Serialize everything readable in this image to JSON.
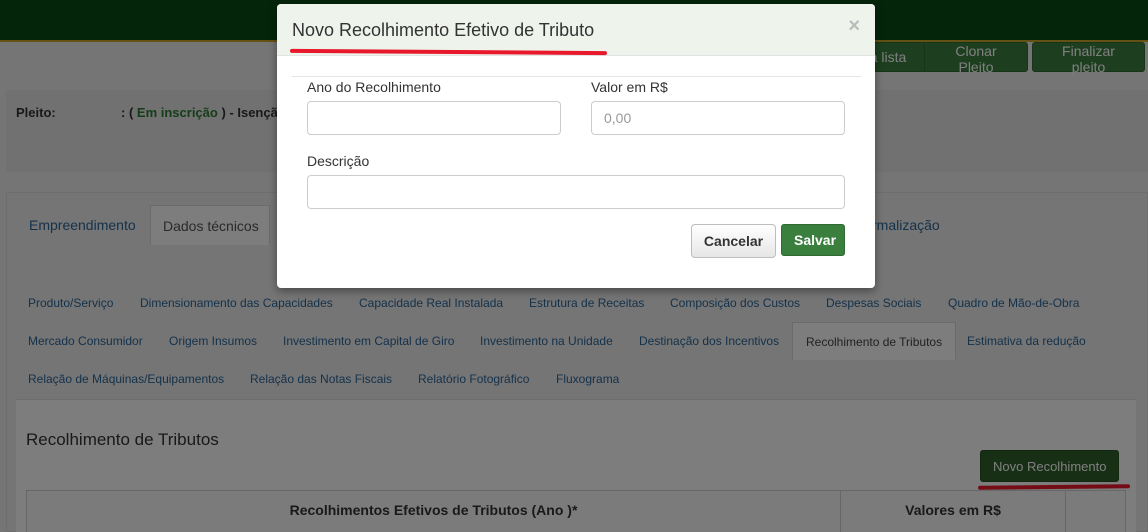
{
  "header": {
    "actions": [
      {
        "label": "a lista"
      },
      {
        "label": "Clonar Pleito"
      },
      {
        "label": "Finalizar pleito"
      }
    ]
  },
  "pleito": {
    "label": "Pleito:",
    "status_prefix": ": (",
    "status": "Em inscrição",
    "status_suffix": ") - Isençã"
  },
  "main_tabs": [
    {
      "label": "Empreendimento",
      "active": false
    },
    {
      "label": "Dados técnicos",
      "active": true
    },
    {
      "label": "rmalização",
      "active": false
    }
  ],
  "sub_tabs": {
    "row1": [
      "Produto/Serviço",
      "Dimensionamento das Capacidades",
      "Capacidade Real Instalada",
      "Estrutura de Receitas",
      "Composição dos Custos",
      "Despesas Sociais",
      "Quadro de Mão-de-Obra"
    ],
    "row2": [
      "Mercado Consumidor",
      "Origem Insumos",
      "Investimento em Capital de Giro",
      "Investimento na Unidade",
      "Destinação dos Incentivos",
      "Recolhimento de Tributos",
      "Estimativa da redução"
    ],
    "row3": [
      "Relação de Máquinas/Equipamentos",
      "Relação das Notas Fiscais",
      "Relatório Fotográfico",
      "Fluxograma"
    ],
    "active": "Recolhimento de Tributos"
  },
  "content": {
    "title": "Recolhimento de Tributos",
    "add_button": "Novo Recolhimento",
    "table_headers": [
      "Recolhimentos Efetivos de Tributos (Ano )*",
      "Valores em R$",
      ""
    ]
  },
  "modal": {
    "title": "Novo Recolhimento Efetivo de Tributo",
    "close_symbol": "×",
    "fields": {
      "ano": {
        "label": "Ano do Recolhimento",
        "value": "",
        "placeholder": ""
      },
      "valor": {
        "label": "Valor em R$",
        "value": "",
        "placeholder": "0,00"
      },
      "descricao": {
        "label": "Descrição",
        "value": "",
        "placeholder": ""
      }
    },
    "cancel_label": "Cancelar",
    "save_label": "Salvar"
  },
  "colors": {
    "topbar": "#0b4a16",
    "accent_green": "#3b7f3f",
    "dark_green_button": "#2f5e2b",
    "annotation_red": "#e8192c",
    "link_blue": "#2a6496"
  }
}
